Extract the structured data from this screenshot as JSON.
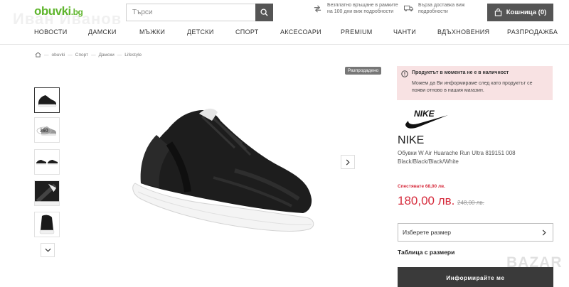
{
  "header": {
    "logo_text": "obuvki",
    "logo_suffix": ".bg",
    "watermark": "Иван Иванов",
    "search_placeholder": "Търси",
    "promo_return": "Безплатно връщане в рамките на 100 дни виж подробности",
    "promo_delivery": "Бърза доставка виж подробности",
    "cart_label": "Кошница (0)"
  },
  "nav": {
    "items": [
      "Новости",
      "Дамски",
      "Мъжки",
      "Детски",
      "Спорт",
      "Аксесоари",
      "Premium",
      "Чанти",
      "Вдъхновения",
      "Разпродажба"
    ]
  },
  "breadcrumb": {
    "items": [
      "obuvki",
      "Спорт",
      "Дамски",
      "Lifestyle"
    ],
    "separator": "—"
  },
  "gallery": {
    "badge": "Разпродадено",
    "thumbnail_icons": [
      "shoe-side-icon",
      "shoe-360-icon",
      "shoe-pair-icon",
      "shoe-detail-icon",
      "shoe-heel-icon"
    ],
    "rotate_label": "360"
  },
  "product": {
    "alert_title": "Продуктът в момента не е в наличност",
    "alert_message": "Можем да Ви информираме след като продуктът се появи отново в нашия магазин.",
    "brand_logo_text": "NIKE",
    "brand": "NIKE",
    "title": "Обувки W Air Huarache Run Ultra 819151 008 Black/Black/Black/White",
    "savings": "Спестявате 68,00 лв.",
    "price": "180,00 лв.",
    "old_price": "248,00 лв.",
    "size_select_label": "Изберете размер",
    "size_table_link": "Таблица с размери",
    "notify_button": "Информирайте ме"
  },
  "footer_watermark": "BAZAR",
  "colors": {
    "brand_green": "#5fb52d",
    "price_red": "#d62b3c",
    "alert_bg": "#f8e2e3",
    "dark_button": "#3a3a3a"
  }
}
